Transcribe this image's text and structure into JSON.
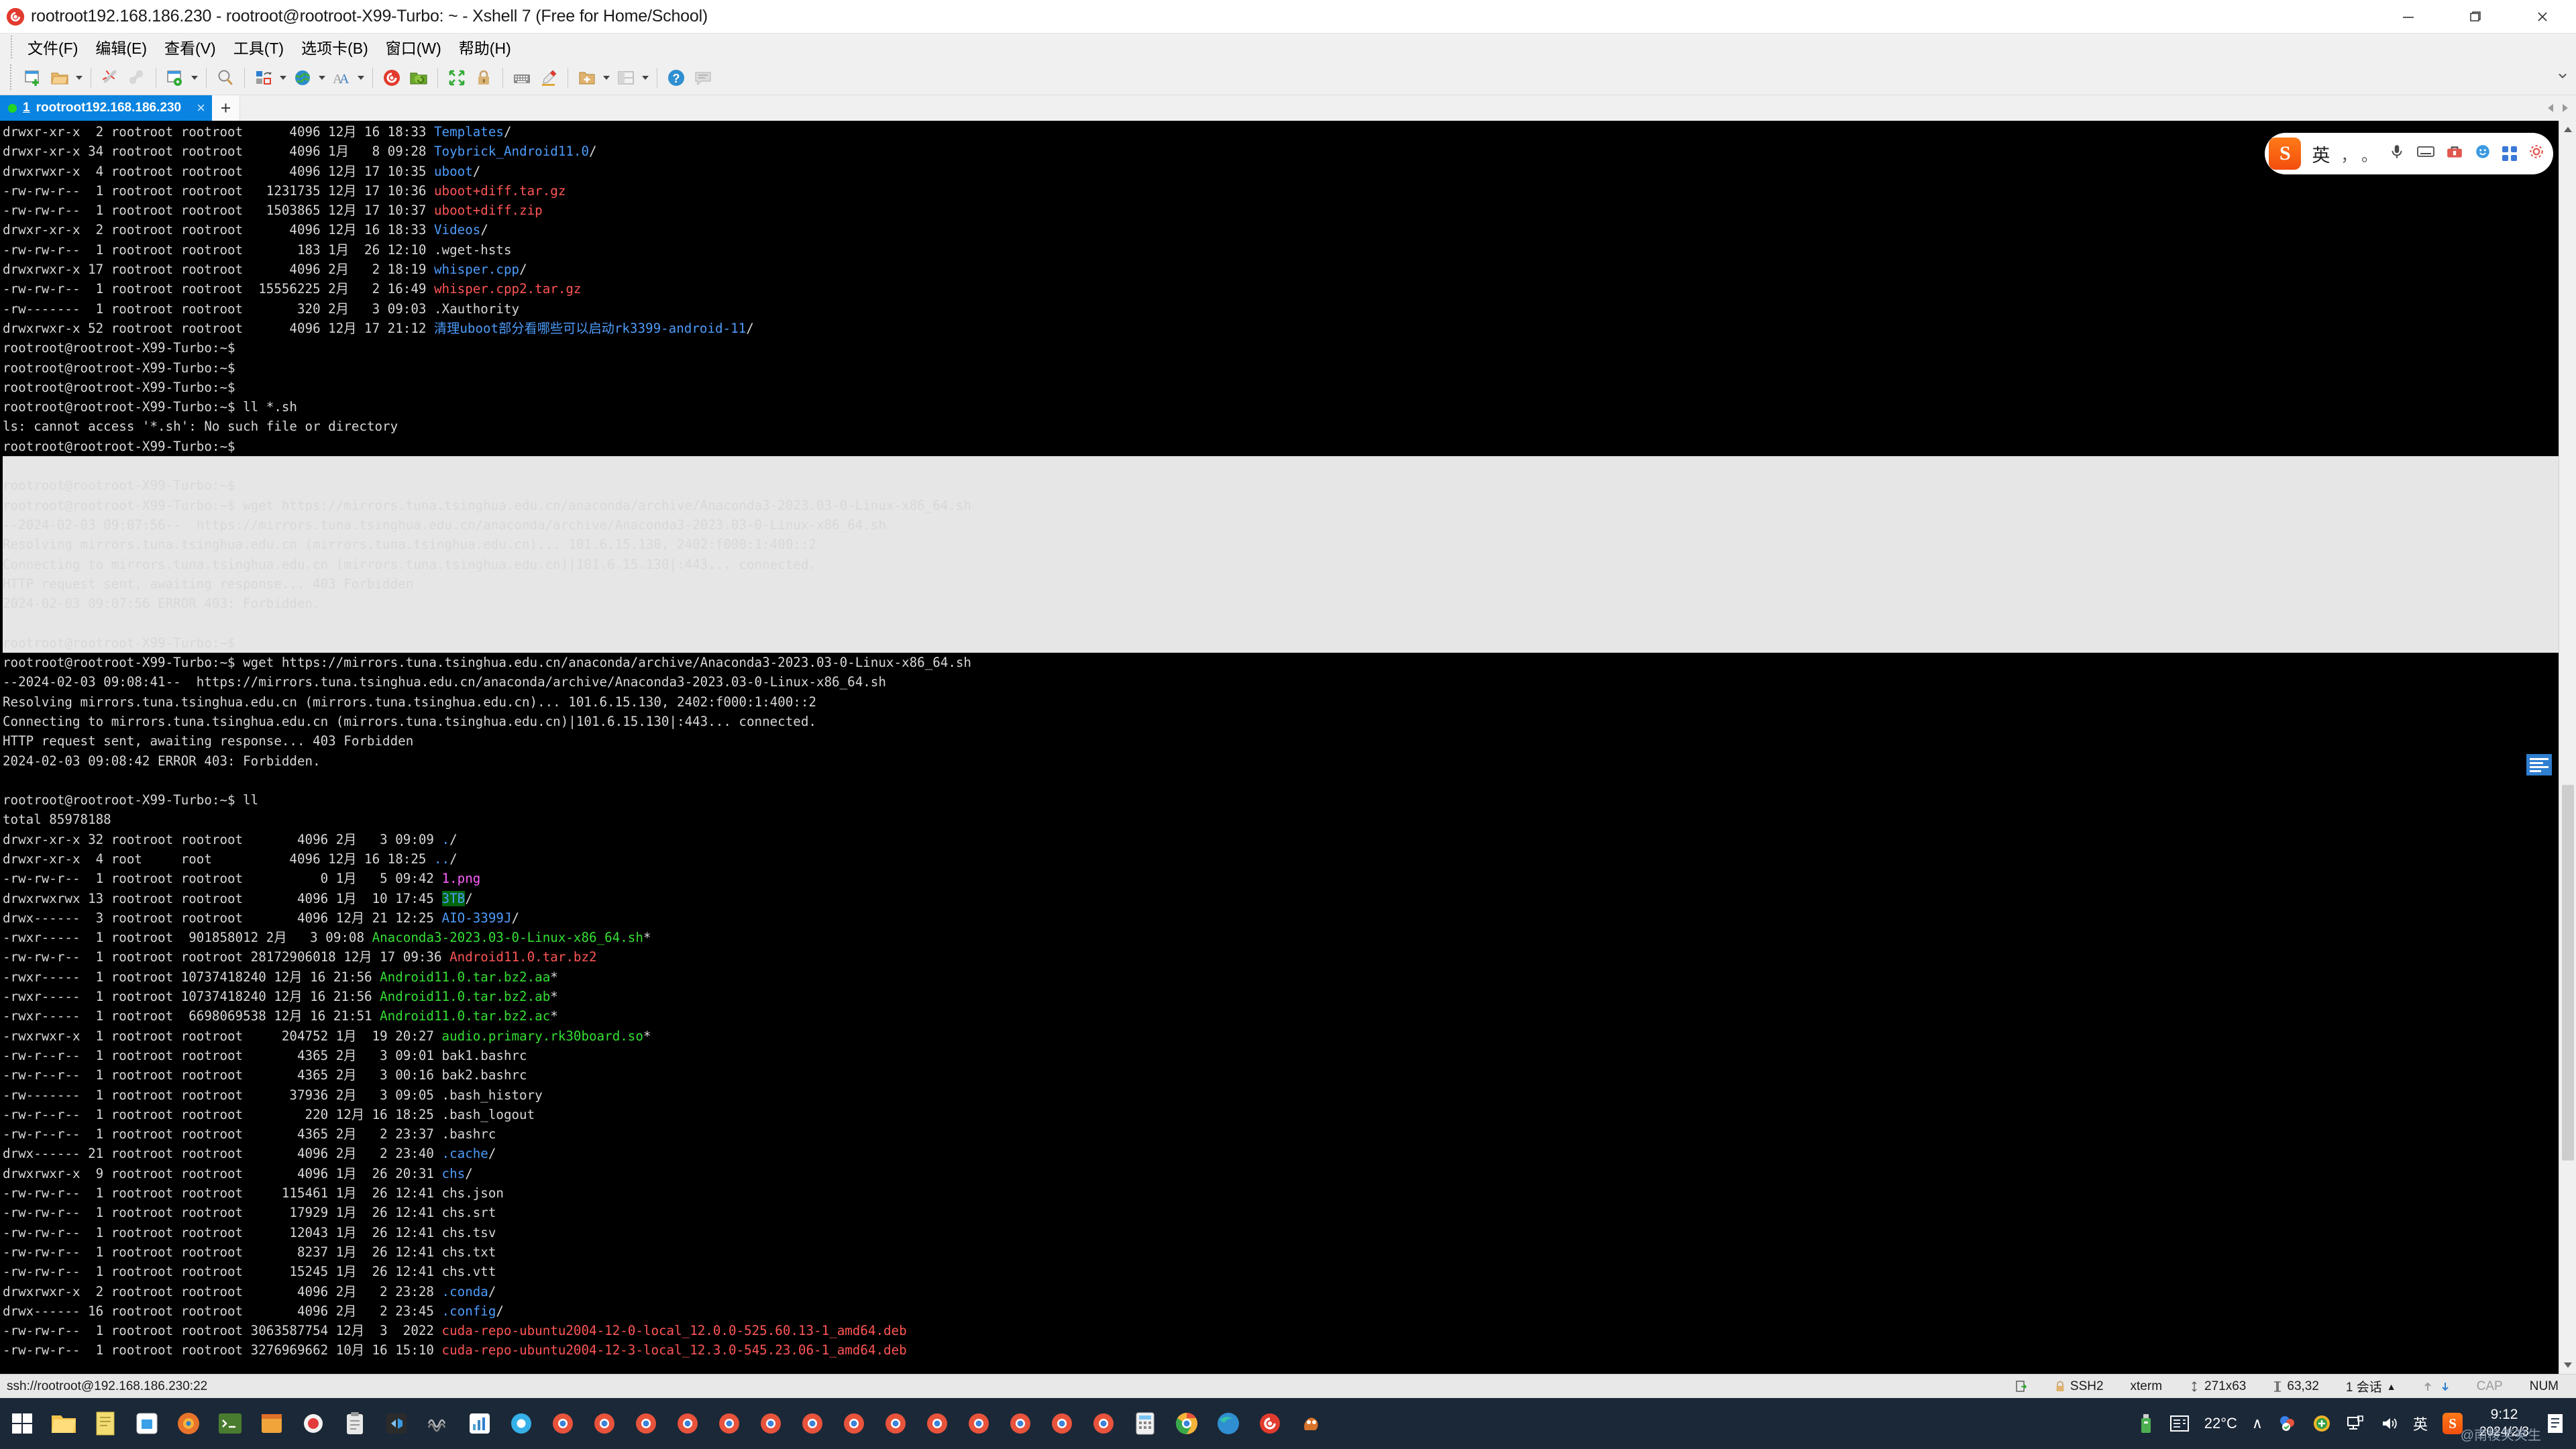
{
  "window": {
    "title": "rootroot192.168.186.230 - rootroot@rootroot-X99-Turbo: ~ - Xshell 7 (Free for Home/School)",
    "app_icon": "xshell-logo-icon",
    "minimize": "minimize-icon",
    "maximize": "maximize-icon",
    "close": "close-icon"
  },
  "menubar": {
    "items": [
      {
        "label": "文件(F)",
        "name": "menu-file"
      },
      {
        "label": "编辑(E)",
        "name": "menu-edit"
      },
      {
        "label": "查看(V)",
        "name": "menu-view"
      },
      {
        "label": "工具(T)",
        "name": "menu-tools"
      },
      {
        "label": "选项卡(B)",
        "name": "menu-tabs"
      },
      {
        "label": "窗口(W)",
        "name": "menu-window"
      },
      {
        "label": "帮助(H)",
        "name": "menu-help"
      }
    ]
  },
  "toolbar": {
    "buttons": [
      "new-session-icon",
      "open-folder-icon",
      "disconnect-icon",
      "reconnect-icon",
      "session-properties-icon",
      "find-icon",
      "transfer-icon",
      "globe-icon",
      "font-icon",
      "xshell-icon",
      "xftp-icon",
      "fullscreen-icon",
      "lock-icon",
      "keyboard-icon",
      "highlight-icon",
      "new-folder-icon",
      "layout-icon",
      "help-icon",
      "comment-icon"
    ]
  },
  "tabbar": {
    "tab": {
      "status": "connected",
      "index": "1",
      "label": "rootroot192.168.186.230",
      "close": "×"
    },
    "new_tab": "+",
    "scroll_left": "scroll-left-icon",
    "scroll_right": "scroll-right-icon"
  },
  "terminal": {
    "lines": [
      {
        "sel": false,
        "spans": [
          {
            "t": "drwxr-xr-x  2 rootroot rootroot      4096 12月 16 18:33 ",
            "c": "w"
          },
          {
            "t": "Templates",
            "c": "b"
          },
          {
            "t": "/",
            "c": "w"
          }
        ]
      },
      {
        "sel": false,
        "spans": [
          {
            "t": "drwxr-xr-x 34 rootroot rootroot      4096 1月   8 09:28 ",
            "c": "w"
          },
          {
            "t": "Toybrick_Android11.0",
            "c": "b"
          },
          {
            "t": "/",
            "c": "w"
          }
        ]
      },
      {
        "sel": false,
        "spans": [
          {
            "t": "drwxrwxr-x  4 rootroot rootroot      4096 12月 17 10:35 ",
            "c": "w"
          },
          {
            "t": "uboot",
            "c": "b"
          },
          {
            "t": "/",
            "c": "w"
          }
        ]
      },
      {
        "sel": false,
        "spans": [
          {
            "t": "-rw-rw-r--  1 rootroot rootroot   1231735 12月 17 10:36 ",
            "c": "w"
          },
          {
            "t": "uboot+diff.tar.gz",
            "c": "r"
          }
        ]
      },
      {
        "sel": false,
        "spans": [
          {
            "t": "-rw-rw-r--  1 rootroot rootroot   1503865 12月 17 10:37 ",
            "c": "w"
          },
          {
            "t": "uboot+diff.zip",
            "c": "r"
          }
        ]
      },
      {
        "sel": false,
        "spans": [
          {
            "t": "drwxr-xr-x  2 rootroot rootroot      4096 12月 16 18:33 ",
            "c": "w"
          },
          {
            "t": "Videos",
            "c": "b"
          },
          {
            "t": "/",
            "c": "w"
          }
        ]
      },
      {
        "sel": false,
        "spans": [
          {
            "t": "-rw-rw-r--  1 rootroot rootroot       183 1月  26 12:10 .wget-hsts",
            "c": "w"
          }
        ]
      },
      {
        "sel": false,
        "spans": [
          {
            "t": "drwxrwxr-x 17 rootroot rootroot      4096 2月   2 18:19 ",
            "c": "w"
          },
          {
            "t": "whisper.cpp",
            "c": "b"
          },
          {
            "t": "/",
            "c": "w"
          }
        ]
      },
      {
        "sel": false,
        "spans": [
          {
            "t": "-rw-rw-r--  1 rootroot rootroot  15556225 2月   2 16:49 ",
            "c": "w"
          },
          {
            "t": "whisper.cpp2.tar.gz",
            "c": "r"
          }
        ]
      },
      {
        "sel": false,
        "spans": [
          {
            "t": "-rw-------  1 rootroot rootroot       320 2月   3 09:03 .Xauthority",
            "c": "w"
          }
        ]
      },
      {
        "sel": false,
        "spans": [
          {
            "t": "drwxrwxr-x 52 rootroot rootroot      4096 12月 17 21:12 ",
            "c": "w"
          },
          {
            "t": "清理uboot部分看哪些可以启动rk3399-android-11",
            "c": "b"
          },
          {
            "t": "/",
            "c": "w"
          }
        ]
      },
      {
        "sel": false,
        "spans": [
          {
            "t": "rootroot@rootroot-X99-Turbo:~$",
            "c": "w"
          }
        ]
      },
      {
        "sel": false,
        "spans": [
          {
            "t": "rootroot@rootroot-X99-Turbo:~$",
            "c": "w"
          }
        ]
      },
      {
        "sel": false,
        "spans": [
          {
            "t": "rootroot@rootroot-X99-Turbo:~$",
            "c": "w"
          }
        ]
      },
      {
        "sel": false,
        "spans": [
          {
            "t": "rootroot@rootroot-X99-Turbo:~$ ll *.sh",
            "c": "w"
          }
        ]
      },
      {
        "sel": false,
        "spans": [
          {
            "t": "ls: cannot access '*.sh': No such file or directory",
            "c": "w"
          }
        ]
      },
      {
        "sel": false,
        "spans": [
          {
            "t": "rootroot@rootroot-X99-Turbo:~$",
            "c": "w"
          }
        ]
      },
      {
        "sel": true,
        "spans": [
          {
            "t": "",
            "c": "w"
          }
        ]
      },
      {
        "sel": true,
        "spans": [
          {
            "t": "rootroot@rootroot-X99-Turbo:~$",
            "c": "w"
          }
        ]
      },
      {
        "sel": true,
        "spans": [
          {
            "t": "rootroot@rootroot-X99-Turbo:~$ wget https://mirrors.tuna.tsinghua.edu.cn/anaconda/archive/Anaconda3-2023.03-0-Linux-x86_64.sh",
            "c": "w"
          }
        ]
      },
      {
        "sel": true,
        "spans": [
          {
            "t": "--2024-02-03 09:07:56--  https://mirrors.tuna.tsinghua.edu.cn/anaconda/archive/Anaconda3-2023.03-0-Linux-x86_64.sh",
            "c": "w"
          }
        ]
      },
      {
        "sel": true,
        "spans": [
          {
            "t": "Resolving mirrors.tuna.tsinghua.edu.cn (mirrors.tuna.tsinghua.edu.cn)... 101.6.15.130, 2402:f000:1:400::2",
            "c": "w"
          }
        ]
      },
      {
        "sel": true,
        "spans": [
          {
            "t": "Connecting to mirrors.tuna.tsinghua.edu.cn (mirrors.tuna.tsinghua.edu.cn)|101.6.15.130|:443... connected.",
            "c": "w"
          }
        ]
      },
      {
        "sel": true,
        "spans": [
          {
            "t": "HTTP request sent, awaiting response... 403 Forbidden",
            "c": "w"
          }
        ]
      },
      {
        "sel": true,
        "spans": [
          {
            "t": "2024-02-03 09:07:56 ERROR 403: Forbidden.",
            "c": "w"
          }
        ]
      },
      {
        "sel": true,
        "spans": [
          {
            "t": "",
            "c": "w"
          }
        ]
      },
      {
        "sel": true,
        "spans": [
          {
            "t": "rootroot@rootroot-X99-Turbo:~$",
            "c": "w"
          }
        ]
      },
      {
        "sel": false,
        "spans": [
          {
            "t": "rootroot@rootroot-X99-Turbo:~$ wget https://mirrors.tuna.tsinghua.edu.cn/anaconda/archive/Anaconda3-2023.03-0-Linux-x86_64.sh",
            "c": "w"
          }
        ]
      },
      {
        "sel": false,
        "spans": [
          {
            "t": "--2024-02-03 09:08:41--  https://mirrors.tuna.tsinghua.edu.cn/anaconda/archive/Anaconda3-2023.03-0-Linux-x86_64.sh",
            "c": "w"
          }
        ]
      },
      {
        "sel": false,
        "spans": [
          {
            "t": "Resolving mirrors.tuna.tsinghua.edu.cn (mirrors.tuna.tsinghua.edu.cn)... 101.6.15.130, 2402:f000:1:400::2",
            "c": "w"
          }
        ]
      },
      {
        "sel": false,
        "spans": [
          {
            "t": "Connecting to mirrors.tuna.tsinghua.edu.cn (mirrors.tuna.tsinghua.edu.cn)|101.6.15.130|:443... connected.",
            "c": "w"
          }
        ]
      },
      {
        "sel": false,
        "spans": [
          {
            "t": "HTTP request sent, awaiting response... 403 Forbidden",
            "c": "w"
          }
        ]
      },
      {
        "sel": false,
        "spans": [
          {
            "t": "2024-02-03 09:08:42 ERROR 403: Forbidden.",
            "c": "w"
          }
        ]
      },
      {
        "sel": false,
        "spans": [
          {
            "t": "",
            "c": "w"
          }
        ]
      },
      {
        "sel": false,
        "spans": [
          {
            "t": "rootroot@rootroot-X99-Turbo:~$ ll",
            "c": "w"
          }
        ]
      },
      {
        "sel": false,
        "spans": [
          {
            "t": "total 85978188",
            "c": "w"
          }
        ]
      },
      {
        "sel": false,
        "spans": [
          {
            "t": "drwxr-xr-x 32 rootroot rootroot       4096 2月   3 09:09 ",
            "c": "w"
          },
          {
            "t": ".",
            "c": "b"
          },
          {
            "t": "/",
            "c": "w"
          }
        ]
      },
      {
        "sel": false,
        "spans": [
          {
            "t": "drwxr-xr-x  4 root     root          4096 12月 16 18:25 ",
            "c": "w"
          },
          {
            "t": "..",
            "c": "b"
          },
          {
            "t": "/",
            "c": "w"
          }
        ]
      },
      {
        "sel": false,
        "spans": [
          {
            "t": "-rw-rw-r--  1 rootroot rootroot          0 1月   5 09:42 ",
            "c": "w"
          },
          {
            "t": "1.png",
            "c": "m"
          }
        ]
      },
      {
        "sel": false,
        "spans": [
          {
            "t": "drwxrwxrwx 13 rootroot rootroot       4096 1月  10 17:45 ",
            "c": "w"
          },
          {
            "t": "3TB",
            "c": "hl"
          },
          {
            "t": "/",
            "c": "w"
          }
        ]
      },
      {
        "sel": false,
        "spans": [
          {
            "t": "drwx------  3 rootroot rootroot       4096 12月 21 12:25 ",
            "c": "w"
          },
          {
            "t": "AIO-3399J",
            "c": "b"
          },
          {
            "t": "/",
            "c": "w"
          }
        ]
      },
      {
        "sel": false,
        "spans": [
          {
            "t": "-rwxr-----  1 rootroot  901858012 2月   3 09:08 ",
            "c": "w"
          },
          {
            "t": "Anaconda3-2023.03-0-Linux-x86_64.sh",
            "c": "g"
          },
          {
            "t": "*",
            "c": "w"
          }
        ]
      },
      {
        "sel": false,
        "spans": [
          {
            "t": "-rw-rw-r--  1 rootroot rootroot 28172906018 12月 17 09:36 ",
            "c": "w"
          },
          {
            "t": "Android11.0.tar.bz2",
            "c": "r"
          }
        ]
      },
      {
        "sel": false,
        "spans": [
          {
            "t": "-rwxr-----  1 rootroot 10737418240 12月 16 21:56 ",
            "c": "w"
          },
          {
            "t": "Android11.0.tar.bz2.aa",
            "c": "g"
          },
          {
            "t": "*",
            "c": "w"
          }
        ]
      },
      {
        "sel": false,
        "spans": [
          {
            "t": "-rwxr-----  1 rootroot 10737418240 12月 16 21:56 ",
            "c": "w"
          },
          {
            "t": "Android11.0.tar.bz2.ab",
            "c": "g"
          },
          {
            "t": "*",
            "c": "w"
          }
        ]
      },
      {
        "sel": false,
        "spans": [
          {
            "t": "-rwxr-----  1 rootroot  6698069538 12月 16 21:51 ",
            "c": "w"
          },
          {
            "t": "Android11.0.tar.bz2.ac",
            "c": "g"
          },
          {
            "t": "*",
            "c": "w"
          }
        ]
      },
      {
        "sel": false,
        "spans": [
          {
            "t": "-rwxrwxr-x  1 rootroot rootroot     204752 1月  19 20:27 ",
            "c": "w"
          },
          {
            "t": "audio.primary.rk30board.so",
            "c": "g"
          },
          {
            "t": "*",
            "c": "w"
          }
        ]
      },
      {
        "sel": false,
        "spans": [
          {
            "t": "-rw-r--r--  1 rootroot rootroot       4365 2月   3 09:01 bak1.bashrc",
            "c": "w"
          }
        ]
      },
      {
        "sel": false,
        "spans": [
          {
            "t": "-rw-r--r--  1 rootroot rootroot       4365 2月   3 00:16 bak2.bashrc",
            "c": "w"
          }
        ]
      },
      {
        "sel": false,
        "spans": [
          {
            "t": "-rw-------  1 rootroot rootroot      37936 2月   3 09:05 .bash_history",
            "c": "w"
          }
        ]
      },
      {
        "sel": false,
        "spans": [
          {
            "t": "-rw-r--r--  1 rootroot rootroot        220 12月 16 18:25 .bash_logout",
            "c": "w"
          }
        ]
      },
      {
        "sel": false,
        "spans": [
          {
            "t": "-rw-r--r--  1 rootroot rootroot       4365 2月   2 23:37 .bashrc",
            "c": "w"
          }
        ]
      },
      {
        "sel": false,
        "spans": [
          {
            "t": "drwx------ 21 rootroot rootroot       4096 2月   2 23:40 ",
            "c": "w"
          },
          {
            "t": ".cache",
            "c": "b"
          },
          {
            "t": "/",
            "c": "w"
          }
        ]
      },
      {
        "sel": false,
        "spans": [
          {
            "t": "drwxrwxr-x  9 rootroot rootroot       4096 1月  26 20:31 ",
            "c": "w"
          },
          {
            "t": "chs",
            "c": "b"
          },
          {
            "t": "/",
            "c": "w"
          }
        ]
      },
      {
        "sel": false,
        "spans": [
          {
            "t": "-rw-rw-r--  1 rootroot rootroot     115461 1月  26 12:41 chs.json",
            "c": "w"
          }
        ]
      },
      {
        "sel": false,
        "spans": [
          {
            "t": "-rw-rw-r--  1 rootroot rootroot      17929 1月  26 12:41 chs.srt",
            "c": "w"
          }
        ]
      },
      {
        "sel": false,
        "spans": [
          {
            "t": "-rw-rw-r--  1 rootroot rootroot      12043 1月  26 12:41 chs.tsv",
            "c": "w"
          }
        ]
      },
      {
        "sel": false,
        "spans": [
          {
            "t": "-rw-rw-r--  1 rootroot rootroot       8237 1月  26 12:41 chs.txt",
            "c": "w"
          }
        ]
      },
      {
        "sel": false,
        "spans": [
          {
            "t": "-rw-rw-r--  1 rootroot rootroot      15245 1月  26 12:41 chs.vtt",
            "c": "w"
          }
        ]
      },
      {
        "sel": false,
        "spans": [
          {
            "t": "drwxrwxr-x  2 rootroot rootroot       4096 2月   2 23:28 ",
            "c": "w"
          },
          {
            "t": ".conda",
            "c": "b"
          },
          {
            "t": "/",
            "c": "w"
          }
        ]
      },
      {
        "sel": false,
        "spans": [
          {
            "t": "drwx------ 16 rootroot rootroot       4096 2月   2 23:45 ",
            "c": "w"
          },
          {
            "t": ".config",
            "c": "b"
          },
          {
            "t": "/",
            "c": "w"
          }
        ]
      },
      {
        "sel": false,
        "spans": [
          {
            "t": "-rw-rw-r--  1 rootroot rootroot 3063587754 12月  3  2022 ",
            "c": "w"
          },
          {
            "t": "cuda-repo-ubuntu2004-12-0-local_12.0.0-525.60.13-1_amd64.deb",
            "c": "r"
          }
        ]
      },
      {
        "sel": false,
        "spans": [
          {
            "t": "-rw-rw-r--  1 rootroot rootroot 3276969662 10月 16 15:10 ",
            "c": "w"
          },
          {
            "t": "cuda-repo-ubuntu2004-12-3-local_12.3.0-545.23.06-1_amd64.deb",
            "c": "r"
          }
        ]
      }
    ]
  },
  "ime": {
    "logo": "sogou-ime-icon",
    "mode": "英",
    "punct": "， 。",
    "mic": "microphone-icon",
    "keyboard": "keyboard-icon",
    "toolbox": "toolbox-icon",
    "emoji": "emoji-icon",
    "apps": "apps-grid-icon",
    "settings": "gear-icon"
  },
  "statusbar": {
    "connection": "ssh://rootroot@192.168.186.230:22",
    "transfer_icon": "transfer-icon",
    "protocol": "SSH2",
    "lock_icon": "lock-icon",
    "term_type": "xterm",
    "size_icon": "size-icon",
    "size": "271x63",
    "cursor_icon": "cursor-icon",
    "cursor": "63,32",
    "sessions": "1 会话",
    "sessions_caret": "▲",
    "up_icon": "arrow-up-icon",
    "down_icon": "arrow-down-icon",
    "cap": "CAP",
    "num": "NUM"
  },
  "taskbar": {
    "start": "windows-start-icon",
    "items": [
      {
        "name": "file-explorer-icon",
        "color": "#ffc83d",
        "glyph": ""
      },
      {
        "name": "notepad-icon",
        "color": "#f0d24b",
        "glyph": ""
      },
      {
        "name": "store-icon",
        "color": "#3aa0e8",
        "glyph": ""
      },
      {
        "name": "edge-icon",
        "color": "#2b88d8",
        "glyph": ""
      },
      {
        "name": "terminal-icon",
        "color": "#3a6b2e",
        "glyph": ""
      },
      {
        "name": "app-orange-icon",
        "color": "#e8732a",
        "glyph": ""
      },
      {
        "name": "record-icon",
        "color": "#e33b3b",
        "glyph": ""
      },
      {
        "name": "clipboard-icon",
        "color": "#d8d8d8",
        "glyph": ""
      },
      {
        "name": "vscode-icon",
        "color": "#333333",
        "glyph": ""
      },
      {
        "name": "media-icon",
        "color": "#9b59b6",
        "glyph": ""
      },
      {
        "name": "chart-icon",
        "color": "#4fa3d1",
        "glyph": ""
      },
      {
        "name": "browser-icon",
        "color": "#35b0e8",
        "glyph": ""
      }
    ],
    "chrome_circles": 14,
    "tray": {
      "show_hidden": "^",
      "usb_icon": "usb-icon",
      "weather_icon": "weather-icon",
      "temperature": "22°C",
      "chevron": "∧",
      "security_icon": "security-icon",
      "shield_icon": "shield-icon",
      "network_icon": "network-icon",
      "volume_icon": "volume-icon",
      "ime_lang": "英",
      "sogou_icon": "sogou-icon",
      "time": "9:12",
      "date": "2024/2/3",
      "notification_icon": "notification-icon",
      "watermark": "@南棱笑笑生"
    }
  }
}
